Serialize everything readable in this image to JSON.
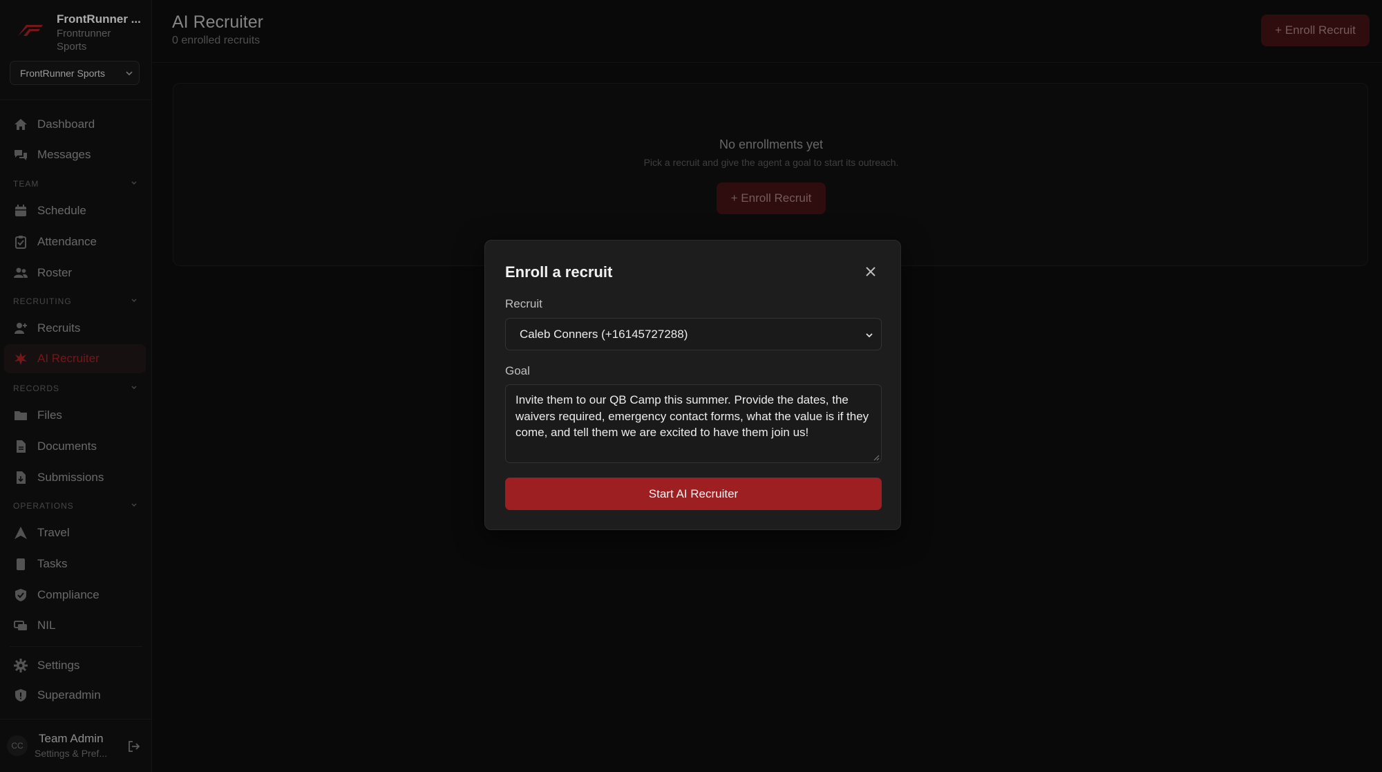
{
  "brand": {
    "name": "FrontRunner ...",
    "subtitle": "Frontrunner Sports",
    "org_selected": "FrontRunner Sports",
    "accent": "#9d1f22"
  },
  "nav": {
    "dashboard": "Dashboard",
    "messages": "Messages",
    "team_section": "TEAM",
    "schedule": "Schedule",
    "attendance": "Attendance",
    "roster": "Roster",
    "recruiting_section": "RECRUITING",
    "recruits": "Recruits",
    "ai_recruiter": "AI Recruiter",
    "records_section": "RECORDS",
    "files": "Files",
    "documents": "Documents",
    "submissions": "Submissions",
    "operations_section": "OPERATIONS",
    "travel": "Travel",
    "tasks": "Tasks",
    "compliance": "Compliance",
    "nil": "NIL",
    "settings": "Settings",
    "superadmin": "Superadmin"
  },
  "profile": {
    "initials": "CC",
    "name": "Team Admin",
    "sub": "Settings & Pref..."
  },
  "header": {
    "title": "AI Recruiter",
    "subtitle": "0 enrolled recruits",
    "enroll_label": "+ Enroll Recruit"
  },
  "empty": {
    "title": "No enrollments yet",
    "subtitle": "Pick a recruit and give the agent a goal to start its outreach.",
    "enroll_label": "+ Enroll Recruit"
  },
  "modal": {
    "title": "Enroll a recruit",
    "recruit_label": "Recruit",
    "recruit_value": "Caleb Conners (+16145727288)",
    "goal_label": "Goal",
    "goal_value": "Invite them to our QB Camp this summer. Provide the dates, the waivers required, emergency contact forms, what the value is if they come, and tell them we are excited to have them join us!",
    "submit_label": "Start AI Recruiter"
  }
}
